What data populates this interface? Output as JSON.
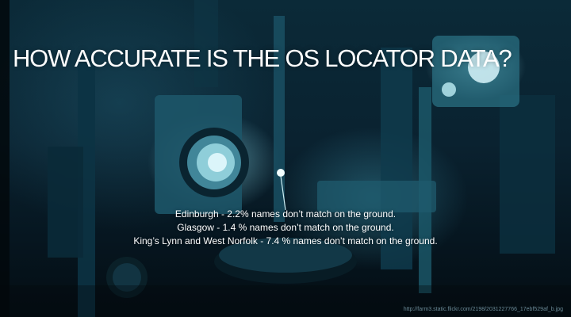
{
  "slide": {
    "title": "HOW ACCURATE IS THE OS LOCATOR DATA?",
    "stats": [
      "Edinburgh - 2.2% names don’t match on the ground.",
      "Glasgow - 1.4 % names don’t match on the ground.",
      "King’s Lynn and West Norfolk - 7.4 % names don’t match on the ground."
    ],
    "source_url": "http://farm3.static.flickr.com/2198/2031227766_17ebf529af_b.jpg"
  },
  "colors": {
    "title_text": "#ffffff",
    "background_dark": "#04111a",
    "highlight_cyan": "#8cdceb"
  }
}
